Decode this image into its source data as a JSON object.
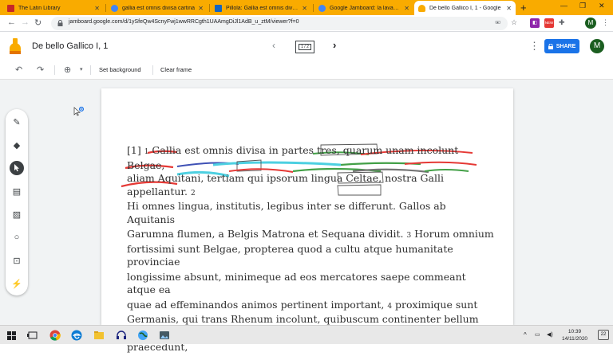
{
  "browser": {
    "tabs": [
      {
        "title": "The Latin Library",
        "favicon_color": "#c62828"
      },
      {
        "title": "gallia est omnis divisa cartina",
        "favicon_color": "#4285f4"
      },
      {
        "title": "Pillola: Gallia est omnis divisa",
        "favicon_color": "#1565c0"
      },
      {
        "title": "Google Jamboard: la lavagna",
        "favicon_color": "#4285f4"
      },
      {
        "title": "De bello Gallico I, 1 - Google",
        "favicon_color": "#f9ab00",
        "active": true
      }
    ],
    "new_tab": "+",
    "url": "jamboard.google.com/d/1ySfeQw4ScnyFwj1wwRRCgth1UAAmgDiJl1AdB_u_ztM/viewer?f=0",
    "profile_initial": "M",
    "extension_badge": "NEW"
  },
  "jamboard": {
    "title": "De bello Gallico I, 1",
    "frame_indicator": "1 / 2",
    "share_label": "SHARE",
    "avatar_initial": "M",
    "toolbar": {
      "set_background": "Set background",
      "clear_frame": "Clear frame"
    },
    "tools": [
      {
        "name": "pen-tool",
        "icon": "pen-icon"
      },
      {
        "name": "eraser-tool",
        "icon": "eraser-icon"
      },
      {
        "name": "select-tool",
        "icon": "pointer-icon",
        "active": true
      },
      {
        "name": "sticky-note-tool",
        "icon": "sticky-note-icon"
      },
      {
        "name": "image-tool",
        "icon": "image-icon"
      },
      {
        "name": "circle-tool",
        "icon": "circle-icon"
      },
      {
        "name": "text-box-tool",
        "icon": "text-box-icon"
      },
      {
        "name": "laser-tool",
        "icon": "laser-icon"
      }
    ],
    "board_lines": [
      [
        "[1] ",
        "1",
        " Gallia est omnis divisa in partes tres, quarum unam incolunt Belgae,"
      ],
      [
        "aliam Aquitani, tertiam qui ipsorum lingua Celtae, nostra Galli appellantur. ",
        "2",
        ""
      ],
      [
        "Hi omnes lingua, institutis, legibus inter se differunt. Gallos ab Aquitanis",
        "",
        ""
      ],
      [
        "Garumna flumen, a Belgis Matrona et Sequana dividit. ",
        "3",
        " Horum omnium"
      ],
      [
        "fortissimi sunt Belgae, propterea quod a cultu atque humanitate provinciae",
        "",
        ""
      ],
      [
        "longissime absunt, minimeque ad eos mercatores saepe commeant atque ea",
        "",
        ""
      ],
      [
        "quae ad effeminandos animos pertinent important, ",
        "4",
        " proximique sunt"
      ],
      [
        "Germanis, qui trans Rhenum incolunt, quibuscum continenter bellum",
        "",
        ""
      ],
      [
        "gerunt. Qua de causa Helvetii quoque reliquos Gallos virtute praecedunt,",
        "",
        ""
      ]
    ]
  },
  "taskbar": {
    "clock_time": "10:39",
    "clock_date": "14/11/2020",
    "notification_count": "22"
  }
}
